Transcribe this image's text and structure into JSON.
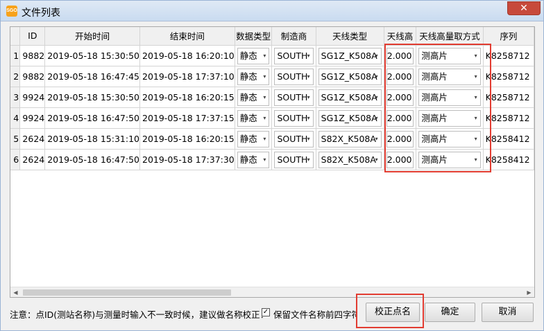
{
  "window": {
    "app_icon_text": "SGO",
    "title": "文件列表",
    "close_glyph": "✕"
  },
  "table": {
    "columns": [
      "",
      "ID",
      "开始时间",
      "结束时间",
      "数据类型",
      "制造商",
      "天线类型",
      "天线高",
      "天线高量取方式",
      "序列"
    ],
    "rows": [
      {
        "n": "1",
        "id": "9882",
        "start": "2019-05-18 15:30:50",
        "end": "2019-05-18 16:20:10",
        "dtype": "静态",
        "maker": "SOUTH",
        "antenna": "SG1Z_K508A",
        "height": "2.000",
        "method": "测高片",
        "serial": "K8258712"
      },
      {
        "n": "2",
        "id": "9882",
        "start": "2019-05-18 16:47:45",
        "end": "2019-05-18 17:37:10",
        "dtype": "静态",
        "maker": "SOUTH",
        "antenna": "SG1Z_K508A",
        "height": "2.000",
        "method": "测高片",
        "serial": "K8258712"
      },
      {
        "n": "3",
        "id": "9924",
        "start": "2019-05-18 15:30:50",
        "end": "2019-05-18 16:20:15",
        "dtype": "静态",
        "maker": "SOUTH",
        "antenna": "SG1Z_K508A",
        "height": "2.000",
        "method": "测高片",
        "serial": "K8258712"
      },
      {
        "n": "4",
        "id": "9924",
        "start": "2019-05-18 16:47:50",
        "end": "2019-05-18 17:37:15",
        "dtype": "静态",
        "maker": "SOUTH",
        "antenna": "SG1Z_K508A",
        "height": "2.000",
        "method": "测高片",
        "serial": "K8258712"
      },
      {
        "n": "5",
        "id": "2624",
        "start": "2019-05-18 15:31:10",
        "end": "2019-05-18 16:20:15",
        "dtype": "静态",
        "maker": "SOUTH",
        "antenna": "S82X_K508A",
        "height": "2.000",
        "method": "测高片",
        "serial": "K8258412"
      },
      {
        "n": "6",
        "id": "2624",
        "start": "2019-05-18 16:47:50",
        "end": "2019-05-18 17:37:30",
        "dtype": "静态",
        "maker": "SOUTH",
        "antenna": "S82X_K508A",
        "height": "2.000",
        "method": "测高片",
        "serial": "K8258412"
      }
    ]
  },
  "footer": {
    "note": "注意：点ID(测站名称)与测量时输入不一致时候，建议做名称校正！",
    "keep_prefix_label": "保留文件名称前四字符",
    "keep_prefix_checked": "✓",
    "buttons": {
      "correct": "校正点名",
      "ok": "确定",
      "cancel": "取消"
    }
  },
  "colors": {
    "highlight": "#e23c31",
    "close_button": "#c7493b"
  },
  "icons": {
    "dropdown": "▾",
    "scroll_left": "◀",
    "scroll_right": "▶"
  }
}
